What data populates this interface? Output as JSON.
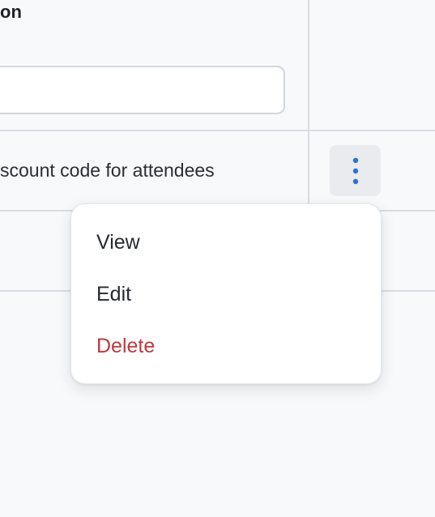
{
  "table": {
    "column_label": "on",
    "filter_input": {
      "value": "",
      "placeholder": ""
    },
    "row": {
      "description": "scount code for attendees"
    }
  },
  "actions_menu": {
    "trigger_icon": "kebab-vertical-icon",
    "items": [
      {
        "label": "View"
      },
      {
        "label": "Edit"
      },
      {
        "label": "Delete"
      }
    ]
  },
  "colors": {
    "background": "#f8f9fb",
    "accent": "#2f6fd6",
    "danger": "#c0383c",
    "border": "#d9dde3"
  }
}
